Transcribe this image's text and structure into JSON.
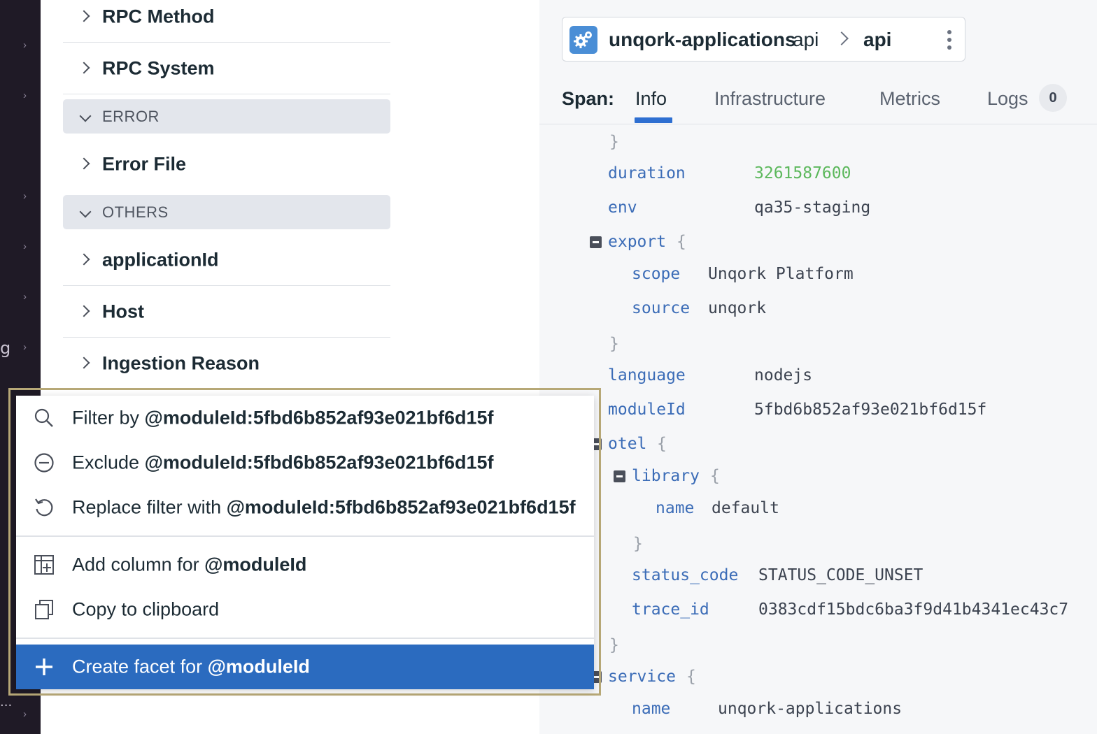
{
  "rail": {
    "partial_text_1": "g",
    "partial_text_2": "..."
  },
  "facets": {
    "items_top": [
      {
        "label": "RPC Method"
      },
      {
        "label": "RPC System"
      }
    ],
    "group_error": {
      "label": "ERROR"
    },
    "error_items": [
      {
        "label": "Error File"
      }
    ],
    "group_others": {
      "label": "OTHERS"
    },
    "other_items": [
      {
        "label": "applicationId"
      },
      {
        "label": "Host"
      },
      {
        "label": "Ingestion Reason"
      }
    ]
  },
  "service_bar": {
    "service_name": "unqork-applications",
    "service_type": "api",
    "operation": "api"
  },
  "tabs": {
    "span_label": "Span:",
    "info": "Info",
    "infrastructure": "Infrastructure",
    "metrics": "Metrics",
    "logs": "Logs",
    "logs_count": "0"
  },
  "attributes": {
    "close_brace": "}",
    "open_brace": "{",
    "duration": {
      "key": "duration",
      "value": "3261587600"
    },
    "env": {
      "key": "env",
      "value": "qa35-staging"
    },
    "export": {
      "key": "export"
    },
    "export_scope": {
      "key": "scope",
      "value": "Unqork Platform"
    },
    "export_source": {
      "key": "source",
      "value": "unqork"
    },
    "language": {
      "key": "language",
      "value": "nodejs"
    },
    "moduleId": {
      "key": "moduleId",
      "value": "5fbd6b852af93e021bf6d15f"
    },
    "otel": {
      "key": "otel"
    },
    "library": {
      "key": "library"
    },
    "library_name": {
      "key": "name",
      "value": "default"
    },
    "status_code": {
      "key": "status_code",
      "value": "STATUS_CODE_UNSET"
    },
    "trace_id": {
      "key": "trace_id",
      "value": "0383cdf15bdc6ba3f9d41b4341ec43c7"
    },
    "service": {
      "key": "service"
    },
    "service_name": {
      "key": "name",
      "value": "unqork-applications"
    }
  },
  "context_menu": {
    "filter": {
      "prefix": "Filter by ",
      "term": "@moduleId:5fbd6b852af93e021bf6d15f"
    },
    "exclude": {
      "prefix": "Exclude ",
      "term": "@moduleId:5fbd6b852af93e021bf6d15f"
    },
    "replace": {
      "prefix": "Replace filter with ",
      "term": "@moduleId:5fbd6b852af93e021bf6d15f"
    },
    "add_column": {
      "prefix": "Add column for ",
      "term": "@moduleId"
    },
    "copy": {
      "label": "Copy to clipboard"
    },
    "create_facet": {
      "prefix": "Create facet for ",
      "term": "@moduleId"
    }
  },
  "colors": {
    "accent": "#2b6bbf",
    "key_blue": "#3b6cb7",
    "number_green": "#5cb85c",
    "rail_dark": "#1f1a26",
    "highlight_frame": "#b7a877"
  }
}
